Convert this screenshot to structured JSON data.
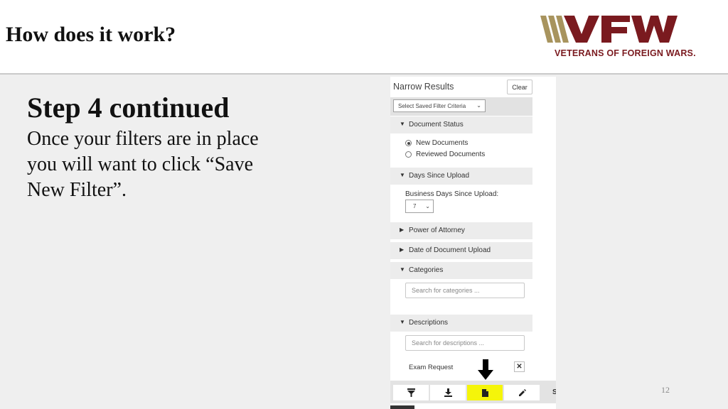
{
  "slide": {
    "title": "How does it work?",
    "step_title": "Step 4 continued",
    "step_body": "Once your filters are in place you will want to click “Save New Filter”.",
    "page_number": "12"
  },
  "logo": {
    "text": "VETERANS OF FOREIGN WARS.",
    "colors": {
      "gold": "#a8945e",
      "red": "#7a1a1f"
    }
  },
  "panel": {
    "title": "Narrow Results",
    "clear_label": "Clear",
    "saved_filter_placeholder": "Select Saved Filter Criteria",
    "sections": {
      "document_status": "Document Status",
      "days_since_upload": "Days Since Upload",
      "power_of_attorney": "Power of Attorney",
      "date_of_document_upload": "Date of Document Upload",
      "categories": "Categories",
      "descriptions": "Descriptions"
    },
    "document_status_options": [
      "New Documents",
      "Reviewed Documents"
    ],
    "document_status_selected": "New Documents",
    "business_days_label": "Business Days Since Upload:",
    "business_days_value": "7",
    "categories_placeholder": "Search for categories ...",
    "descriptions_placeholder": "Search for descriptions ...",
    "selected_description": "Exam Request",
    "remove_icon": "close-icon",
    "toolbar": {
      "buttons": [
        "filter-icon",
        "download-icon",
        "save-new-filter-icon",
        "edit-icon"
      ],
      "highlight_color": "#f5f50a",
      "trailing_text": "S"
    }
  }
}
